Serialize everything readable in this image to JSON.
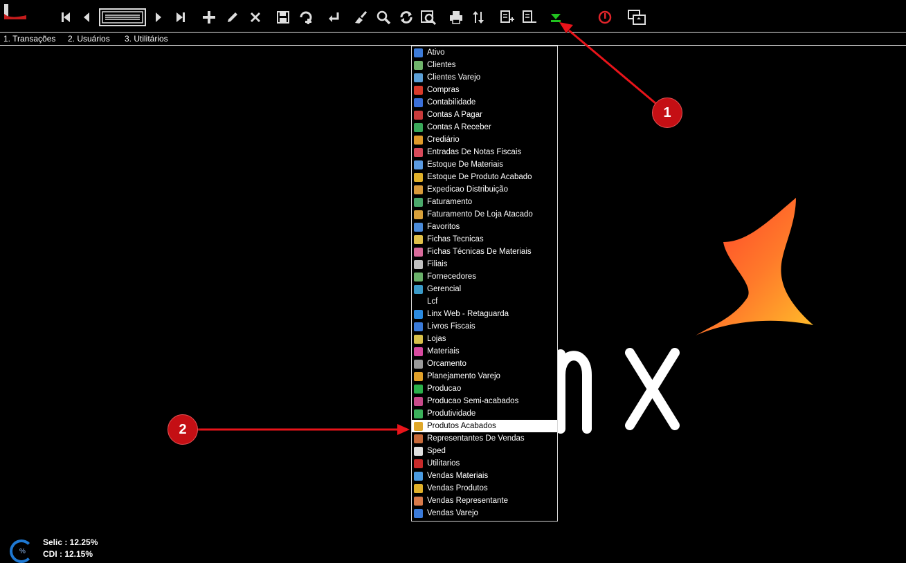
{
  "toolbar": {
    "buttons": [
      {
        "name": "first-record-icon"
      },
      {
        "name": "previous-record-icon"
      },
      {
        "name": "record-list-icon"
      },
      {
        "name": "next-record-icon"
      },
      {
        "name": "last-record-icon"
      },
      {
        "name": "add-icon"
      },
      {
        "name": "edit-icon"
      },
      {
        "name": "delete-icon"
      },
      {
        "name": "save-icon"
      },
      {
        "name": "copy-icon"
      },
      {
        "name": "undo-icon"
      },
      {
        "name": "clear-icon"
      },
      {
        "name": "search-icon"
      },
      {
        "name": "refresh-icon"
      },
      {
        "name": "zoom-window-icon"
      },
      {
        "name": "print-icon"
      },
      {
        "name": "sort-icon"
      },
      {
        "name": "expand-icon"
      },
      {
        "name": "collapse-icon"
      },
      {
        "name": "module-dropdown-icon"
      },
      {
        "name": "power-icon"
      },
      {
        "name": "switch-window-icon"
      }
    ],
    "accent_color": "#21c21f",
    "power_color": "#e0242a"
  },
  "menubar": {
    "items": [
      "1. Transações",
      "2. Usuários",
      "3. Utilitários"
    ]
  },
  "dropdown": {
    "selected_index": 30,
    "items": [
      {
        "label": "Ativo",
        "color": "#3d7bd8"
      },
      {
        "label": "Clientes",
        "color": "#6fb36b"
      },
      {
        "label": "Clientes Varejo",
        "color": "#5c9fd6"
      },
      {
        "label": "Compras",
        "color": "#d83a2a"
      },
      {
        "label": "Contabilidade",
        "color": "#3a6fd8"
      },
      {
        "label": "Contas A Pagar",
        "color": "#c83a3a"
      },
      {
        "label": "Contas A Receber",
        "color": "#3aa85a"
      },
      {
        "label": "Crediário",
        "color": "#e09a2a"
      },
      {
        "label": "Entradas De Notas Fiscais",
        "color": "#d84a5a"
      },
      {
        "label": "Estoque De Materiais",
        "color": "#5a9ae0"
      },
      {
        "label": "Estoque De Produto Acabado",
        "color": "#e0b02a"
      },
      {
        "label": "Expedicao Distribuição",
        "color": "#d89a3a"
      },
      {
        "label": "Faturamento",
        "color": "#4aa86a"
      },
      {
        "label": "Faturamento De Loja Atacado",
        "color": "#d8a03a"
      },
      {
        "label": "Favoritos",
        "color": "#4a8ad8"
      },
      {
        "label": "Fichas Tecnicas",
        "color": "#e0c04a"
      },
      {
        "label": "Fichas Técnicas De Materiais",
        "color": "#d86a9a"
      },
      {
        "label": "Filiais",
        "color": "#c0c0c0"
      },
      {
        "label": "Fornecedores",
        "color": "#6ab06a"
      },
      {
        "label": "Gerencial",
        "color": "#3a9ac8"
      },
      {
        "label": "Lcf",
        "color": "#000000"
      },
      {
        "label": "Linx Web - Retaguarda",
        "color": "#2a8ae0"
      },
      {
        "label": "Livros Fiscais",
        "color": "#3a7ad8"
      },
      {
        "label": "Lojas",
        "color": "#d8c04a"
      },
      {
        "label": "Materiais",
        "color": "#d84aa0"
      },
      {
        "label": "Orcamento",
        "color": "#9a9a9a"
      },
      {
        "label": "Planejamento Varejo",
        "color": "#e0a02a"
      },
      {
        "label": "Producao",
        "color": "#2ab04a"
      },
      {
        "label": "Producao Semi-acabados",
        "color": "#c84a8a"
      },
      {
        "label": "Produtividade",
        "color": "#3ab05a"
      },
      {
        "label": "Produtos Acabados",
        "color": "#e0a82a"
      },
      {
        "label": "Representantes De Vendas",
        "color": "#c86a3a"
      },
      {
        "label": "Sped",
        "color": "#e0e0e0"
      },
      {
        "label": "Utilitarios",
        "color": "#c82a2a"
      },
      {
        "label": "Vendas Materiais",
        "color": "#4a9ae0"
      },
      {
        "label": "Vendas Produtos",
        "color": "#e0b02a"
      },
      {
        "label": "Vendas Representante",
        "color": "#d87a4a"
      },
      {
        "label": "Vendas Varejo",
        "color": "#3a7ad8"
      }
    ]
  },
  "callouts": {
    "one": "1",
    "two": "2"
  },
  "status": {
    "gauge_label": "%",
    "selic": "Selic : 12.25%",
    "cdi": "CDI : 12.15%"
  },
  "background_logo": {
    "text": "nx",
    "colors": [
      "#ff3a2a",
      "#ff8a2a",
      "#ffc02a"
    ]
  }
}
